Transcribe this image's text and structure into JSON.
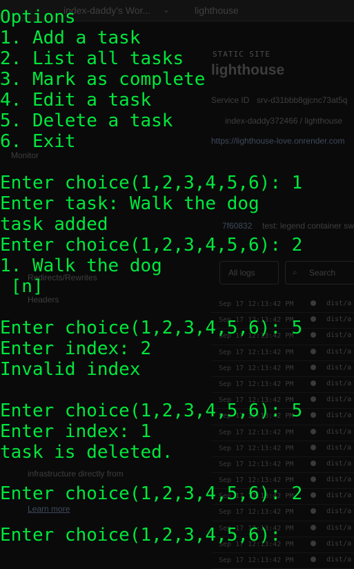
{
  "background": {
    "workspace": "index-daddy's Wor...",
    "project": "lighthouse",
    "service_type_label": "STATIC SITE",
    "service_name": "lighthouse",
    "service_id_label": "Service ID",
    "service_id": "srv-d31bbb8gjcnc73at5q",
    "repo": "index-daddy372466 / lighthouse",
    "url": "https://lighthouse-love.onrender.com",
    "sidebar_item_1": "Monitor",
    "sidebar_item_2": "Headers",
    "sidebar_item_3": "Redirects/Rewrites",
    "promo_text_1": "infrastructure directly from",
    "promo_link": "Learn more",
    "commit_hash": "7f60832",
    "commit_msg": "test: legend container sw",
    "filter_label": "All logs",
    "search_placeholder": "Search",
    "log_timestamp": "Sep 17 12:13:42 PM",
    "log_msg": "dist/a"
  },
  "terminal": {
    "lines": [
      "Options",
      "1. Add a task",
      "2. List all tasks",
      "3. Mark as complete",
      "4. Edit a task",
      "5. Delete a task",
      "6. Exit",
      "",
      "Enter choice(1,2,3,4,5,6): 1",
      "Enter task: Walk the dog",
      "task added",
      "Enter choice(1,2,3,4,5,6): 2",
      "1. Walk the dog",
      " [n]",
      "",
      "Enter choice(1,2,3,4,5,6): 5",
      "Enter index: 2",
      "Invalid index",
      "",
      "Enter choice(1,2,3,4,5,6): 5",
      "Enter index: 1",
      "task is deleted.",
      "",
      "Enter choice(1,2,3,4,5,6): 2",
      "",
      "Enter choice(1,2,3,4,5,6): "
    ]
  },
  "colors": {
    "terminal_text": "#00e83c",
    "background": "#0a0a0a"
  }
}
